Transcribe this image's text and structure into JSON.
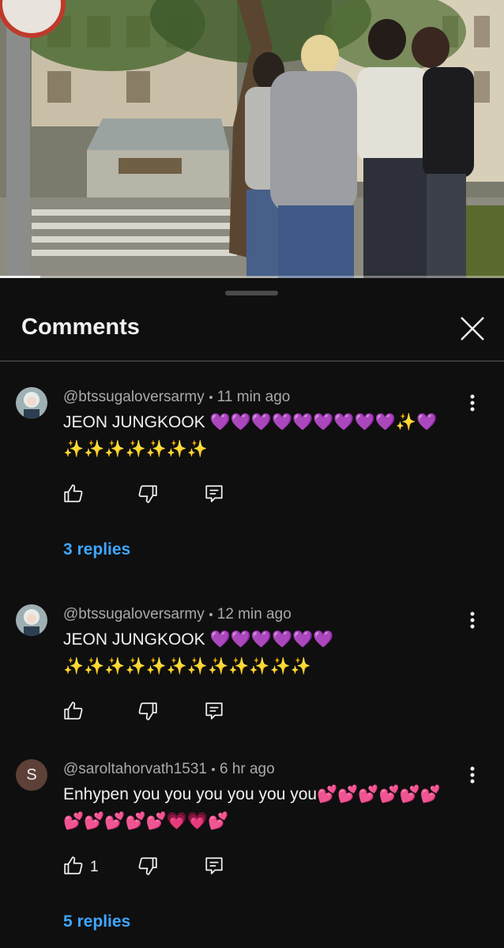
{
  "video": {
    "progress": 0.08
  },
  "sheet": {
    "title": "Comments",
    "close_icon": "close-icon"
  },
  "comments": [
    {
      "author": "@btssugaloversarmy",
      "time": "11 min ago",
      "line1": "JEON JUNGKOOK 💜💜💜💜💜💜💜💜💜✨💜",
      "line2": "✨✨✨✨✨✨✨",
      "like_count": "",
      "replies": "3 replies"
    },
    {
      "author": "@btssugaloversarmy",
      "time": "12 min ago",
      "line1": "JEON JUNGKOOK 💜💜💜💜💜💜",
      "line2": "✨✨✨✨✨✨✨✨✨✨✨✨",
      "like_count": "",
      "replies": ""
    },
    {
      "author": "@saroltahorvath1531",
      "avatar_letter": "S",
      "time": "6 hr ago",
      "line1": "Enhypen you you you you you you💕💕💕💕💕💕",
      "line2": "💕💕💕💕💕💗💗💕",
      "like_count": "1",
      "replies": "5 replies"
    }
  ],
  "icons": [
    "thumb-up-icon",
    "thumb-down-icon",
    "reply-icon",
    "more-vert-icon"
  ],
  "colors": {
    "background": "#0f0f0f",
    "link": "#3ea6ff",
    "meta": "#aaaaaa"
  }
}
